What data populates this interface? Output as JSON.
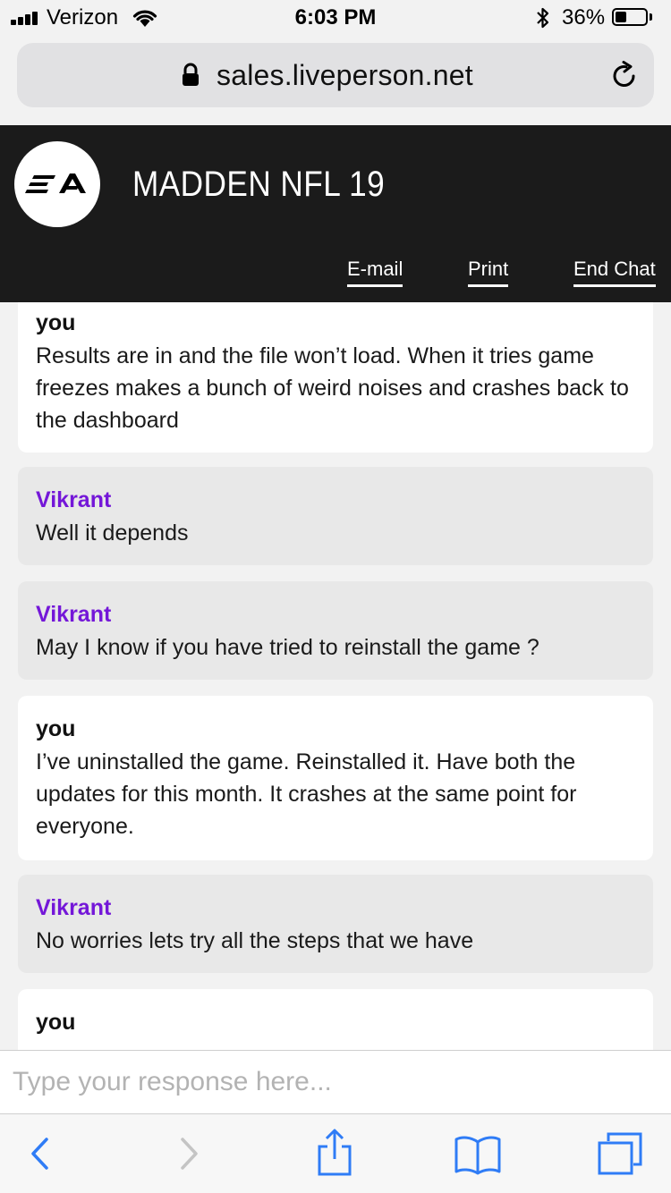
{
  "status_bar": {
    "carrier": "Verizon",
    "time": "6:03 PM",
    "battery_percent": "36%",
    "battery_level": 0.36,
    "signal_bars": 4
  },
  "browser": {
    "url": "sales.liveperson.net"
  },
  "header": {
    "logo_icon": "ea-logo",
    "title": "MADDEN NFL 19",
    "links": {
      "email": "E-mail",
      "print": "Print",
      "end_chat": "End Chat"
    }
  },
  "messages": [
    {
      "sender": "you",
      "type": "user",
      "text": "Results are in and the file won’t load. When it tries game freezes makes a bunch of weird noises and crashes back to the dashboard"
    },
    {
      "sender": "Vikrant",
      "type": "agent",
      "text": "Well it depends"
    },
    {
      "sender": "Vikrant",
      "type": "agent",
      "text": "May I know if you have tried to reinstall the game ?"
    },
    {
      "sender": "you",
      "type": "user",
      "text": "I’ve uninstalled the game. Reinstalled it. Have both the updates for this month. It crashes at the same point for everyone."
    },
    {
      "sender": "Vikrant",
      "type": "agent",
      "text": "No worries lets try all the steps that we have"
    },
    {
      "sender": "you",
      "type": "user",
      "text": ""
    }
  ],
  "composer": {
    "placeholder": "Type your response here..."
  },
  "colors": {
    "agent_name": "#7417d8",
    "header_bg": "#1b1b1b",
    "ios_blue": "#2f7cf6"
  }
}
